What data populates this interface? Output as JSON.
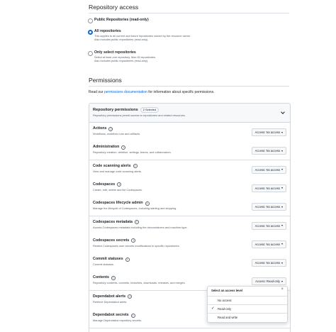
{
  "repo_access": {
    "heading": "Repository access",
    "options": [
      {
        "label": "Public Repositories (read-only)",
        "desc": [],
        "checked": false
      },
      {
        "label": "All repositories",
        "desc": [
          "This applies to all current and future repositories owned by the resource owner.",
          "Also includes public repositories (read-only)."
        ],
        "checked": true
      },
      {
        "label": "Only select repositories",
        "desc": [
          "Select at least one repository. Max 50 repositories.",
          "Also includes public repositories (read-only)."
        ],
        "checked": false
      }
    ]
  },
  "permissions": {
    "heading": "Permissions",
    "intro_prefix": "Read our ",
    "intro_link": "permissions documentation",
    "intro_suffix": " for information about specific permissions.",
    "group": {
      "title": "Repository permissions",
      "badge": "2 Selected",
      "desc": "Repository permissions permit access to repositories and related resources."
    },
    "rows": [
      {
        "title": "Actions",
        "desc": "Workflows, workflow runs and artifacts.",
        "access": "Access: No access"
      },
      {
        "title": "Administration",
        "desc": "Repository creation, deletion, settings, teams, and collaborators.",
        "access": "Access: No access"
      },
      {
        "title": "Code scanning alerts",
        "desc": "View and manage code scanning alerts.",
        "access": "Access: No access"
      },
      {
        "title": "Codespaces",
        "desc": "Create, edit, delete and list Codespaces.",
        "access": "Access: No access"
      },
      {
        "title": "Codespaces lifecycle admin",
        "desc": "Manage the lifecycle of Codespaces, including starting and stopping.",
        "access": "Access: No access"
      },
      {
        "title": "Codespaces metadata",
        "desc": "Access Codespaces metadata including the devcontainers and machine type.",
        "access": "Access: No access"
      },
      {
        "title": "Codespaces secrets",
        "desc": "Restrict Codespaces user secrets modifications to specific repositories.",
        "access": "Access: No access"
      },
      {
        "title": "Commit statuses",
        "desc": "Commit statuses.",
        "access": "Access: No access"
      },
      {
        "title": "Contents",
        "desc": "Repository contents, commits, branches, downloads, releases, and merges.",
        "access": "Access: Read-only"
      },
      {
        "title": "Dependabot alerts",
        "desc": "Retrieve Dependabot alerts.",
        "access": ""
      },
      {
        "title": "Dependabot secrets",
        "desc": "Manage Dependabot repository secrets.",
        "access": ""
      }
    ]
  },
  "access_menu": {
    "title": "Select an access level",
    "items": [
      {
        "label": "No access",
        "selected": false
      },
      {
        "label": "Read-only",
        "selected": true
      },
      {
        "label": "Read and write",
        "selected": false
      }
    ]
  }
}
